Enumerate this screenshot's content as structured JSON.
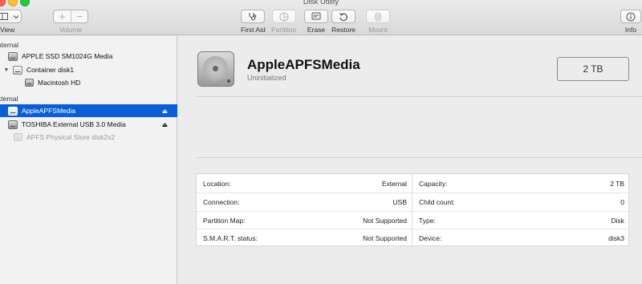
{
  "window": {
    "title": "Disk Utility"
  },
  "colors": {
    "close": "#ff5f57",
    "minimize": "#febc2e",
    "zoom": "#28c840",
    "selection": "#0a5fd8"
  },
  "toolbar": {
    "view_label": "View",
    "volume_label": "Volume",
    "volume_add": "+",
    "volume_remove": "−",
    "first_aid_label": "First Aid",
    "partition_label": "Partition",
    "erase_label": "Erase",
    "restore_label": "Restore",
    "mount_label": "Mount",
    "info_label": "Info",
    "icons": {
      "view": "sidebar-icon",
      "first_aid": "stethoscope-icon",
      "partition": "pie-chart-icon",
      "erase": "eraser-icon",
      "restore": "restore-arrow-icon",
      "mount": "mount-icon",
      "info": "info-icon"
    }
  },
  "sidebar": {
    "internal_header": "nternal",
    "external_header": "xternal",
    "internal_items": [
      {
        "label": "APPLE SSD SM1024G Media",
        "icon": "internal-disk-icon"
      },
      {
        "label": "Container disk1",
        "icon": "container-icon",
        "expanded": true
      },
      {
        "label": "Macintosh HD",
        "icon": "volume-icon"
      }
    ],
    "external_items": [
      {
        "label": "AppleAPFSMedia",
        "icon": "external-disk-icon",
        "selected": true,
        "eject": "⏏"
      },
      {
        "label": "TOSHIBA External USB 3.0 Media",
        "icon": "external-disk-icon",
        "eject": "⏏"
      },
      {
        "label": "APFS Physical Store disk2s2",
        "icon": "volume-icon",
        "dimmed": true
      }
    ]
  },
  "detail": {
    "name": "AppleAPFSMedia",
    "status": "Uninitialized",
    "size": "2 TB"
  },
  "info": {
    "left": [
      {
        "label": "Location:",
        "value": "External"
      },
      {
        "label": "Connection:",
        "value": "USB"
      },
      {
        "label": "Partition Map:",
        "value": "Not Supported"
      },
      {
        "label": "S.M.A.R.T. status:",
        "value": "Not Supported"
      }
    ],
    "right": [
      {
        "label": "Capacity:",
        "value": "2 TB"
      },
      {
        "label": "Child count:",
        "value": "0"
      },
      {
        "label": "Type:",
        "value": "Disk"
      },
      {
        "label": "Device:",
        "value": "disk3"
      }
    ]
  }
}
